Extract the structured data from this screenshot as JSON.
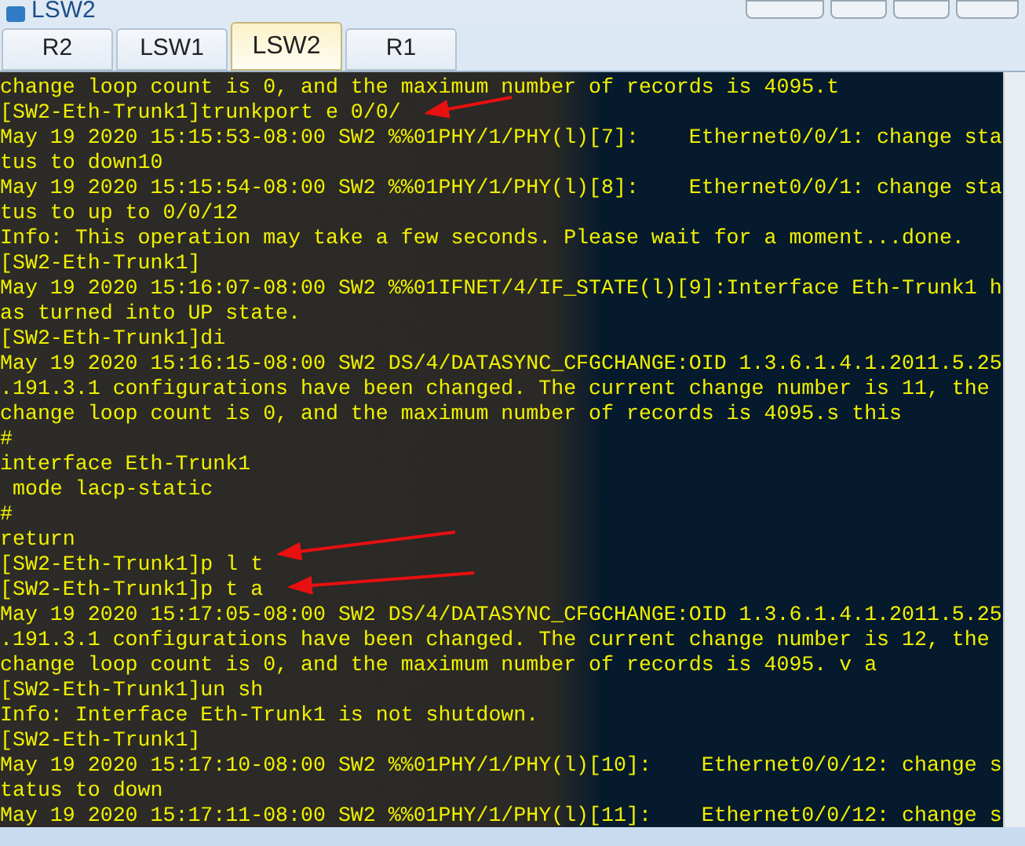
{
  "window": {
    "title": "LSW2"
  },
  "tabs": [
    {
      "label": "R2",
      "selected": false
    },
    {
      "label": "LSW1",
      "selected": false
    },
    {
      "label": "LSW2",
      "selected": true
    },
    {
      "label": "R1",
      "selected": false
    }
  ],
  "terminal": {
    "lines": [
      "change loop count is 0, and the maximum number of records is 4095.t",
      "[SW2-Eth-Trunk1]trunkport e 0/0/",
      "May 19 2020 15:15:53-08:00 SW2 %%01PHY/1/PHY(l)[7]:    Ethernet0/0/1: change sta",
      "tus to down10",
      "May 19 2020 15:15:54-08:00 SW2 %%01PHY/1/PHY(l)[8]:    Ethernet0/0/1: change sta",
      "tus to up to 0/0/12",
      "Info: This operation may take a few seconds. Please wait for a moment...done.",
      "[SW2-Eth-Trunk1]",
      "May 19 2020 15:16:07-08:00 SW2 %%01IFNET/4/IF_STATE(l)[9]:Interface Eth-Trunk1 h",
      "as turned into UP state.",
      "[SW2-Eth-Trunk1]di",
      "May 19 2020 15:16:15-08:00 SW2 DS/4/DATASYNC_CFGCHANGE:OID 1.3.6.1.4.1.2011.5.25",
      ".191.3.1 configurations have been changed. The current change number is 11, the",
      "change loop count is 0, and the maximum number of records is 4095.s this",
      "#",
      "interface Eth-Trunk1",
      " mode lacp-static",
      "#",
      "return",
      "[SW2-Eth-Trunk1]p l t",
      "[SW2-Eth-Trunk1]p t a",
      "May 19 2020 15:17:05-08:00 SW2 DS/4/DATASYNC_CFGCHANGE:OID 1.3.6.1.4.1.2011.5.25",
      ".191.3.1 configurations have been changed. The current change number is 12, the",
      "change loop count is 0, and the maximum number of records is 4095. v a",
      "[SW2-Eth-Trunk1]un sh",
      "Info: Interface Eth-Trunk1 is not shutdown.",
      "[SW2-Eth-Trunk1]",
      "May 19 2020 15:17:10-08:00 SW2 %%01PHY/1/PHY(l)[10]:    Ethernet0/0/12: change s",
      "tatus to down",
      "May 19 2020 15:17:11-08:00 SW2 %%01PHY/1/PHY(l)[11]:    Ethernet0/0/12: change s"
    ]
  }
}
